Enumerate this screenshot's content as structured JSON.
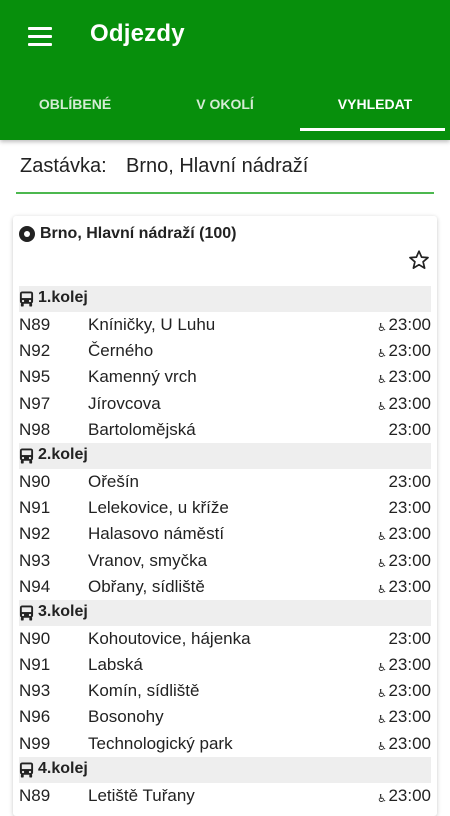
{
  "app": {
    "title": "Odjezdy"
  },
  "tabs": [
    {
      "label": "OBLÍBENÉ",
      "active": false
    },
    {
      "label": "V OKOLÍ",
      "active": false
    },
    {
      "label": "VYHLEDAT",
      "active": true
    }
  ],
  "search": {
    "label": "Zastávka:",
    "value": "Brno, Hlavní nádraží"
  },
  "card": {
    "title": "Brno, Hlavní nádraží (100)"
  },
  "icons": {
    "menu": "menu-icon",
    "stop": "stop-marker-icon",
    "favorite": "star-outline-icon",
    "platform": "bus-icon",
    "accessible": "wheelchair-icon"
  },
  "colors": {
    "primary": "#078f0c",
    "accent_line": "#4cb84f",
    "group_bg": "#eeeeee"
  },
  "wheelchair_glyph": "♿",
  "groups": [
    {
      "name": "1.kolej",
      "departures": [
        {
          "line": "N89",
          "destination": "Kníničky, U Luhu",
          "time": "23:00",
          "accessible": true
        },
        {
          "line": "N92",
          "destination": "Černého",
          "time": "23:00",
          "accessible": true
        },
        {
          "line": "N95",
          "destination": "Kamenný vrch",
          "time": "23:00",
          "accessible": true
        },
        {
          "line": "N97",
          "destination": "Jírovcova",
          "time": "23:00",
          "accessible": true
        },
        {
          "line": "N98",
          "destination": "Bartolomějská",
          "time": "23:00",
          "accessible": false
        }
      ]
    },
    {
      "name": "2.kolej",
      "departures": [
        {
          "line": "N90",
          "destination": "Ořešín",
          "time": "23:00",
          "accessible": false
        },
        {
          "line": "N91",
          "destination": "Lelekovice, u kříže",
          "time": "23:00",
          "accessible": false
        },
        {
          "line": "N92",
          "destination": "Halasovo náměstí",
          "time": "23:00",
          "accessible": true
        },
        {
          "line": "N93",
          "destination": "Vranov, smyčka",
          "time": "23:00",
          "accessible": true
        },
        {
          "line": "N94",
          "destination": "Obřany, sídliště",
          "time": "23:00",
          "accessible": true
        }
      ]
    },
    {
      "name": "3.kolej",
      "departures": [
        {
          "line": "N90",
          "destination": "Kohoutovice, hájenka",
          "time": "23:00",
          "accessible": false
        },
        {
          "line": "N91",
          "destination": "Labská",
          "time": "23:00",
          "accessible": true
        },
        {
          "line": "N93",
          "destination": "Komín, sídliště",
          "time": "23:00",
          "accessible": true
        },
        {
          "line": "N96",
          "destination": "Bosonohy",
          "time": "23:00",
          "accessible": true
        },
        {
          "line": "N99",
          "destination": "Technologický park",
          "time": "23:00",
          "accessible": true
        }
      ]
    },
    {
      "name": "4.kolej",
      "departures": [
        {
          "line": "N89",
          "destination": "Letiště Tuřany",
          "time": "23:00",
          "accessible": true
        }
      ]
    }
  ]
}
